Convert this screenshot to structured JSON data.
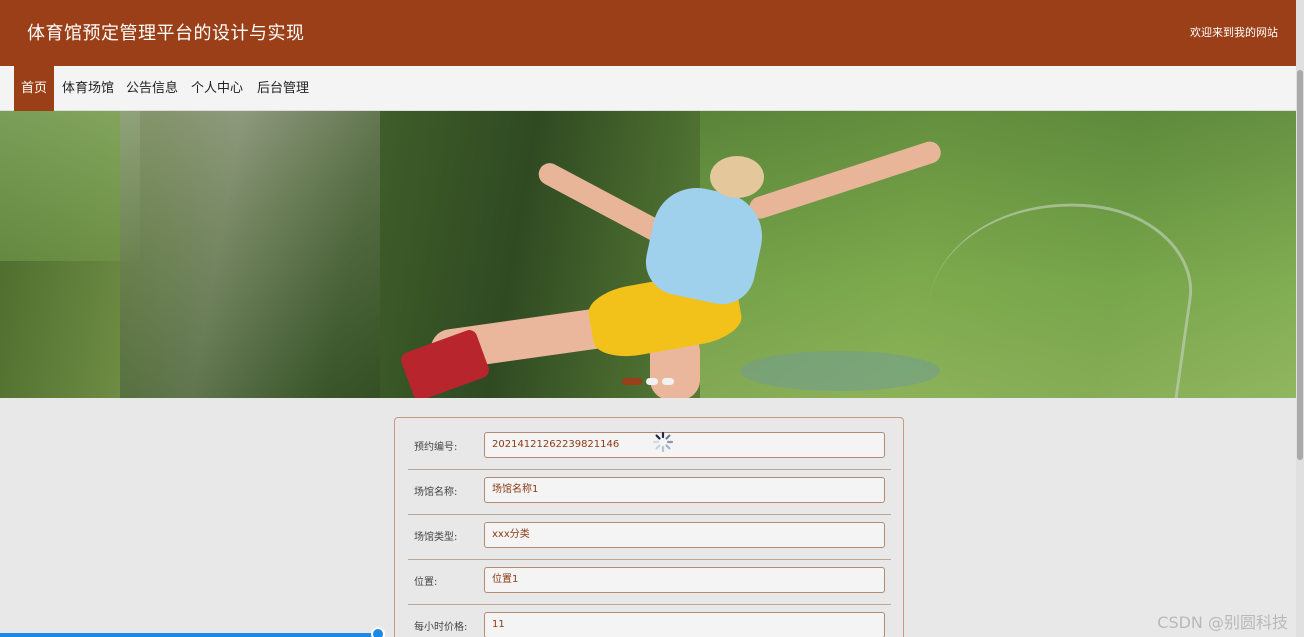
{
  "header": {
    "title": "体育馆预定管理平台的设计与实现",
    "welcome": "欢迎来到我的网站"
  },
  "nav": {
    "items": [
      {
        "label": "首页",
        "active": true
      },
      {
        "label": "体育场馆"
      },
      {
        "label": "公告信息"
      },
      {
        "label": "个人中心"
      },
      {
        "label": "后台管理"
      }
    ]
  },
  "banner": {
    "image": "bungee-jumper-over-valley",
    "slides": 3,
    "active_slide": 1
  },
  "form": {
    "fields": [
      {
        "label": "预约编号:",
        "value": "20214121262239821146"
      },
      {
        "label": "场馆名称:",
        "value": "场馆名称1"
      },
      {
        "label": "场馆类型:",
        "value": "xxx分类"
      },
      {
        "label": "位置:",
        "value": "位置1"
      },
      {
        "label": "每小时价格:",
        "value": "11"
      }
    ]
  },
  "watermark": "CSDN @别圆科技",
  "colors": {
    "brand": "#9a3f17",
    "nav_bg": "#f4f4f4",
    "page_bg": "#e8e8e8",
    "accent_blue": "#1e88e5"
  },
  "icons": {
    "spinner": "loading-spinner-icon"
  }
}
